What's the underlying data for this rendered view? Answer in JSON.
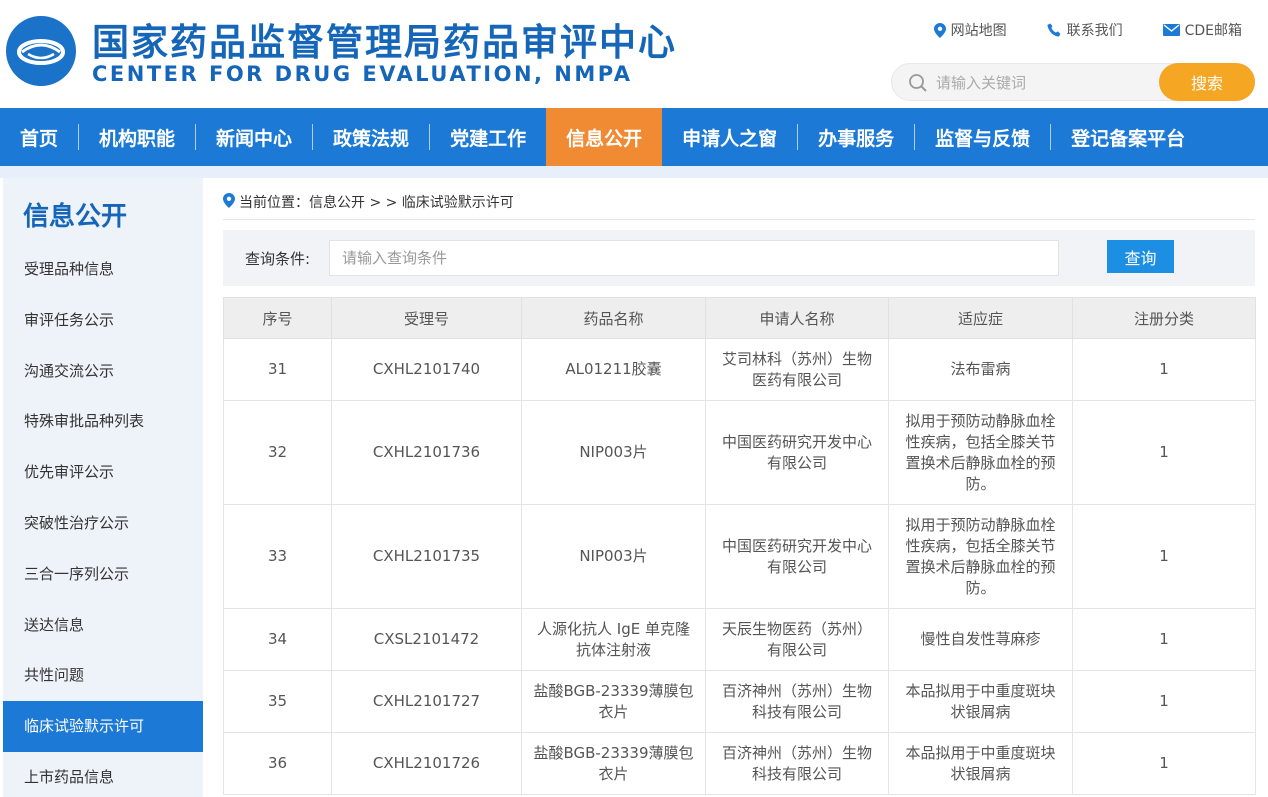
{
  "site": {
    "title_cn": "国家药品监督管理局药品审评中心",
    "title_en": "CENTER FOR DRUG EVALUATION, NMPA"
  },
  "top_links": [
    {
      "label": "网站地图",
      "icon": "location-pin-icon"
    },
    {
      "label": "联系我们",
      "icon": "phone-icon"
    },
    {
      "label": "CDE邮箱",
      "icon": "mail-icon"
    }
  ],
  "search": {
    "placeholder": "请输入关键词",
    "button": "搜索"
  },
  "nav": [
    {
      "label": "首页",
      "active": false
    },
    {
      "label": "机构职能",
      "active": false
    },
    {
      "label": "新闻中心",
      "active": false
    },
    {
      "label": "政策法规",
      "active": false
    },
    {
      "label": "党建工作",
      "active": false
    },
    {
      "label": "信息公开",
      "active": true
    },
    {
      "label": "申请人之窗",
      "active": false
    },
    {
      "label": "办事服务",
      "active": false
    },
    {
      "label": "监督与反馈",
      "active": false
    },
    {
      "label": "登记备案平台",
      "active": false
    }
  ],
  "sidebar": {
    "title": "信息公开",
    "items": [
      {
        "label": "受理品种信息",
        "active": false
      },
      {
        "label": "审评任务公示",
        "active": false
      },
      {
        "label": "沟通交流公示",
        "active": false
      },
      {
        "label": "特殊审批品种列表",
        "active": false
      },
      {
        "label": "优先审评公示",
        "active": false
      },
      {
        "label": "突破性治疗公示",
        "active": false
      },
      {
        "label": "三合一序列公示",
        "active": false
      },
      {
        "label": "送达信息",
        "active": false
      },
      {
        "label": "共性问题",
        "active": false
      },
      {
        "label": "临床试验默示许可",
        "active": true
      },
      {
        "label": "上市药品信息",
        "active": false
      }
    ]
  },
  "breadcrumb": {
    "text": "当前位置：信息公开 > > 临床试验默示许可"
  },
  "query": {
    "label": "查询条件:",
    "placeholder": "请输入查询条件",
    "button": "查询"
  },
  "table": {
    "headers": [
      "序号",
      "受理号",
      "药品名称",
      "申请人名称",
      "适应症",
      "注册分类"
    ],
    "rows": [
      [
        "31",
        "CXHL2101740",
        "AL01211胶囊",
        "艾司林科（苏州）生物医药有限公司",
        "法布雷病",
        "1"
      ],
      [
        "32",
        "CXHL2101736",
        "NIP003片",
        "中国医药研究开发中心有限公司",
        "拟用于预防动静脉血栓性疾病，包括全膝关节置换术后静脉血栓的预防。",
        "1"
      ],
      [
        "33",
        "CXHL2101735",
        "NIP003片",
        "中国医药研究开发中心有限公司",
        "拟用于预防动静脉血栓性疾病，包括全膝关节置换术后静脉血栓的预防。",
        "1"
      ],
      [
        "34",
        "CXSL2101472",
        "人源化抗人 IgE 单克隆抗体注射液",
        "天辰生物医药（苏州）有限公司",
        "慢性自发性荨麻疹",
        "1"
      ],
      [
        "35",
        "CXHL2101727",
        "盐酸BGB-23339薄膜包衣片",
        "百济神州（苏州）生物科技有限公司",
        "本品拟用于中重度斑块状银屑病",
        "1"
      ],
      [
        "36",
        "CXHL2101726",
        "盐酸BGB-23339薄膜包衣片",
        "百济神州（苏州）生物科技有限公司",
        "本品拟用于中重度斑块状银屑病",
        "1"
      ]
    ]
  },
  "colors": {
    "brand_blue": "#1c7ad6",
    "title_blue": "#1566b8",
    "active_orange": "#f08b34",
    "search_orange": "#f5a623"
  }
}
